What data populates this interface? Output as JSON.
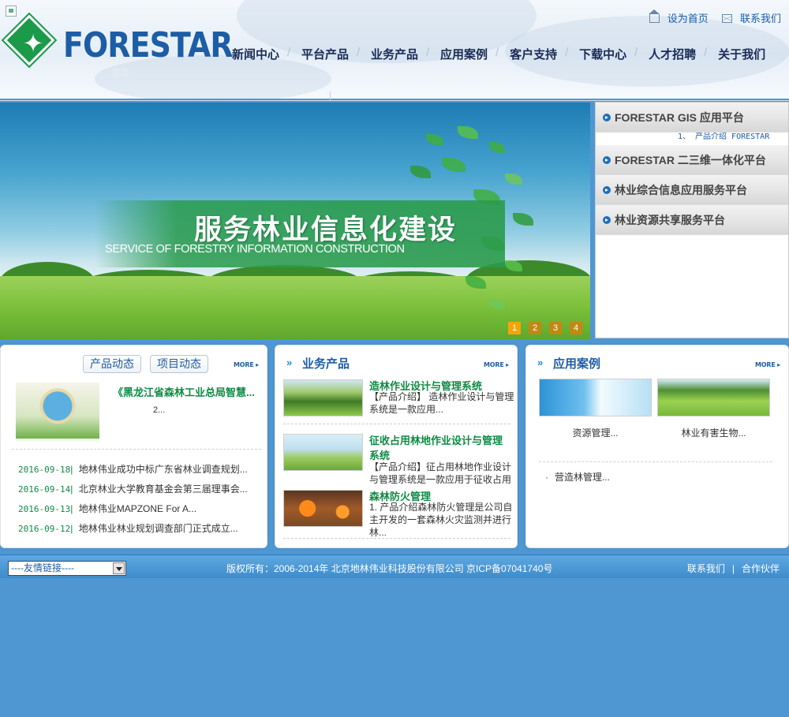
{
  "header": {
    "logo_text": "FORESTAR",
    "top_links": [
      "设为首页",
      "联系我们"
    ],
    "nav": [
      "新闻中心",
      "平台产品",
      "业务产品",
      "应用案例",
      "客户支持",
      "下载中心",
      "人才招聘",
      "关于我们"
    ],
    "ghost": "首页"
  },
  "banner": {
    "title": "服务林业信息化建设",
    "subtitle": "SERVICE OF FORESTRY INFORMATION CONSTRUCTION",
    "dots": [
      "1",
      "2",
      "3",
      "4"
    ],
    "active_dot": "1"
  },
  "platforms": {
    "items": [
      "FORESTAR GIS 应用平台",
      "FORESTAR 二三维一体化平台",
      "林业综合信息应用服务平台",
      "林业资源共享服务平台"
    ],
    "sub_text": "1、 产品介绍 FORESTAR"
  },
  "news": {
    "tabs": [
      "产品动态",
      "项目动态"
    ],
    "more": "MORE",
    "headline": "《黑龙江省森林工业总局智慧...",
    "headline_cont": "2...",
    "rows": [
      {
        "date": "2016-09-18",
        "title": "地林伟业成功中标广东省林业调查规划..."
      },
      {
        "date": "2016-09-14",
        "title": "北京林业大学教育基金会第三届理事会..."
      },
      {
        "date": "2016-09-13",
        "title": "地林伟业MAPZONE For A..."
      },
      {
        "date": "2016-09-12",
        "title": "地林伟业林业规划调查部门正式成立..."
      }
    ]
  },
  "business": {
    "title": "业务产品",
    "more": "MORE",
    "items": [
      {
        "name": "造林作业设计与管理系统",
        "desc": "【产品介绍】 造林作业设计与管理系统是一款应用..."
      },
      {
        "name": "征收占用林地作业设计与管理系统",
        "desc": "【产品介绍】征占用林地作业设计与管理系统是一款应用于征收占用"
      },
      {
        "name": "森林防火管理",
        "desc": "1. 产品介绍森林防火管理是公司自主开发的一套森林火灾监测并进行林..."
      }
    ]
  },
  "cases": {
    "title": "应用案例",
    "more": "MORE",
    "items": [
      "资源管理...",
      "林业有害生物..."
    ],
    "list": [
      "营造林管理..."
    ]
  },
  "footer": {
    "friend_links": "----友情链接----",
    "copyright": "版权所有：2006-2014年 北京地林伟业科技股份有限公司  京ICP备07041740号",
    "links": [
      "联系我们",
      "合作伙伴"
    ]
  },
  "colors": {
    "brand_blue": "#1d5da5",
    "news_green": "#0f8a43",
    "footer_blue": "#4f97d3"
  }
}
